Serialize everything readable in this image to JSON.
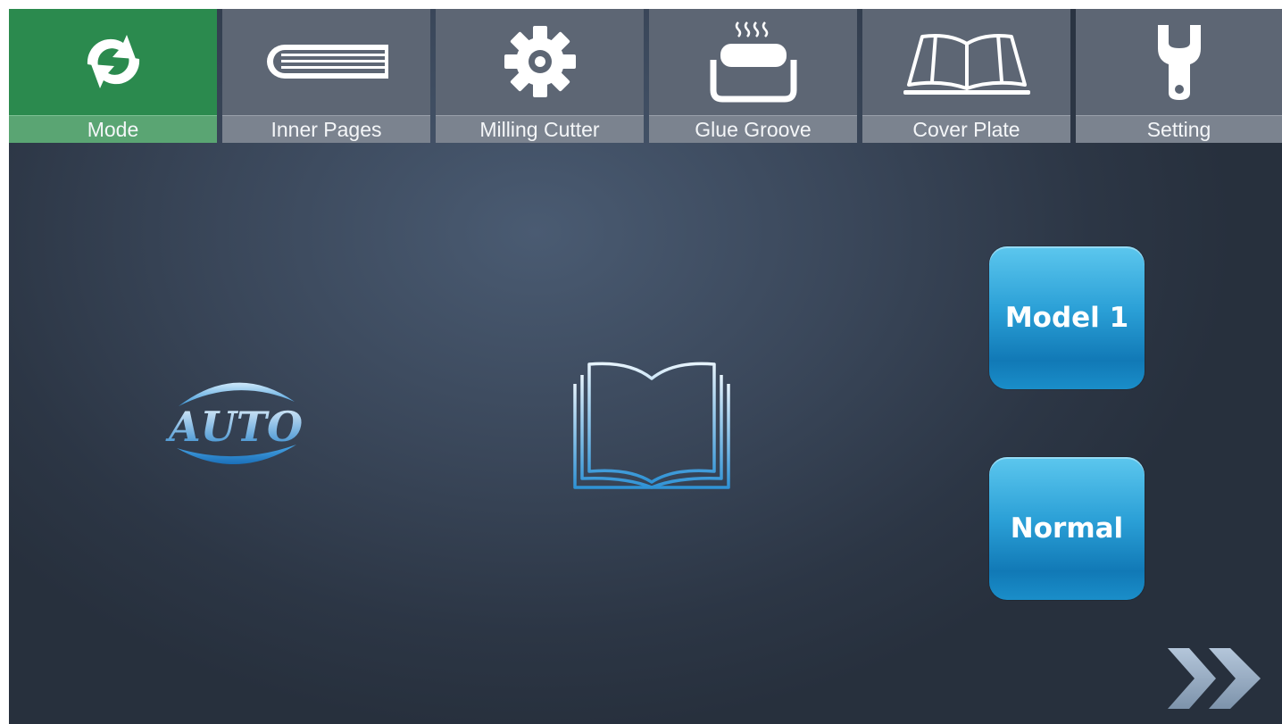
{
  "tabs": [
    {
      "label": "Mode",
      "icon": "refresh-icon",
      "active": true
    },
    {
      "label": "Inner Pages",
      "icon": "book-stack-icon",
      "active": false
    },
    {
      "label": "Milling Cutter",
      "icon": "gear-icon",
      "active": false
    },
    {
      "label": "Glue Groove",
      "icon": "glue-heater-icon",
      "active": false
    },
    {
      "label": "Cover Plate",
      "icon": "open-book-outline-icon",
      "active": false
    },
    {
      "label": "Setting",
      "icon": "wrench-icon",
      "active": false
    }
  ],
  "main": {
    "logo_text": "AUTO",
    "model_button": "Model 1",
    "normal_button": "Normal",
    "next_icon": "double-chevron-right-icon"
  },
  "colors": {
    "active_tab": "#2b8a4e",
    "inactive_tab": "#5d6674",
    "button_blue": "#2a9fd6",
    "background": "#3a475a"
  }
}
